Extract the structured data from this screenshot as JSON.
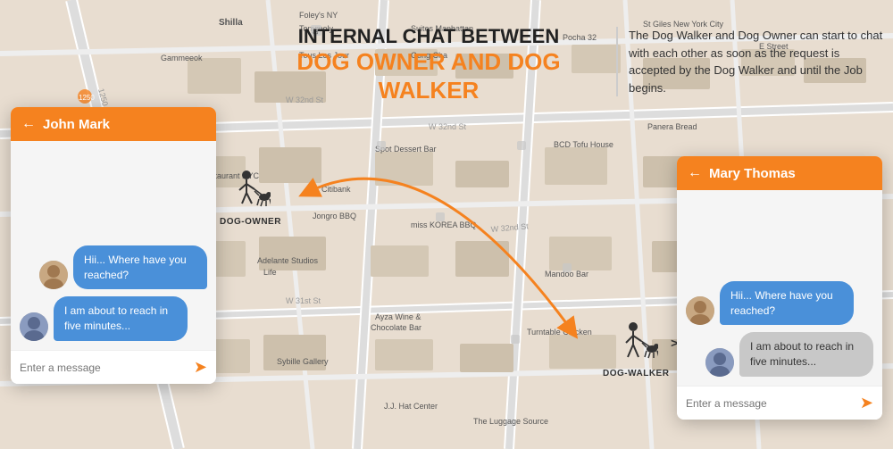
{
  "map": {
    "bgColor": "#e8e0d8"
  },
  "centerPanel": {
    "line1": "INTERNAL CHAT BETWEEN",
    "line2": "DOG OWNER AND DOG",
    "line3": "WALKER"
  },
  "descPanel": {
    "text": "The Dog Walker and Dog Owner can start to chat with each other as soon as the request is accepted by the Dog Walker and until the Job begins."
  },
  "chatLeft": {
    "headerName": "John Mark",
    "backArrow": "←",
    "messages": [
      {
        "type": "right",
        "text": "Hii... Where have you reached?",
        "bubble": "blue"
      },
      {
        "type": "left",
        "text": "I am about to reach in five minutes...",
        "bubble": "blue_left"
      }
    ],
    "inputPlaceholder": "Enter a message"
  },
  "chatRight": {
    "headerName": "Mary Thomas",
    "backArrow": "←",
    "messages": [
      {
        "type": "left",
        "text": "Hii... Where have you reached?",
        "bubble": "blue"
      },
      {
        "type": "right",
        "text": "I am about to reach in five minutes...",
        "bubble": "gray"
      }
    ],
    "inputPlaceholder": "Enter a message"
  },
  "dogOwnerLabel": "DOG-OWNER",
  "dogWalkerLabel": "DOG-WALKER",
  "icons": {
    "back": "←",
    "send": "➤"
  }
}
